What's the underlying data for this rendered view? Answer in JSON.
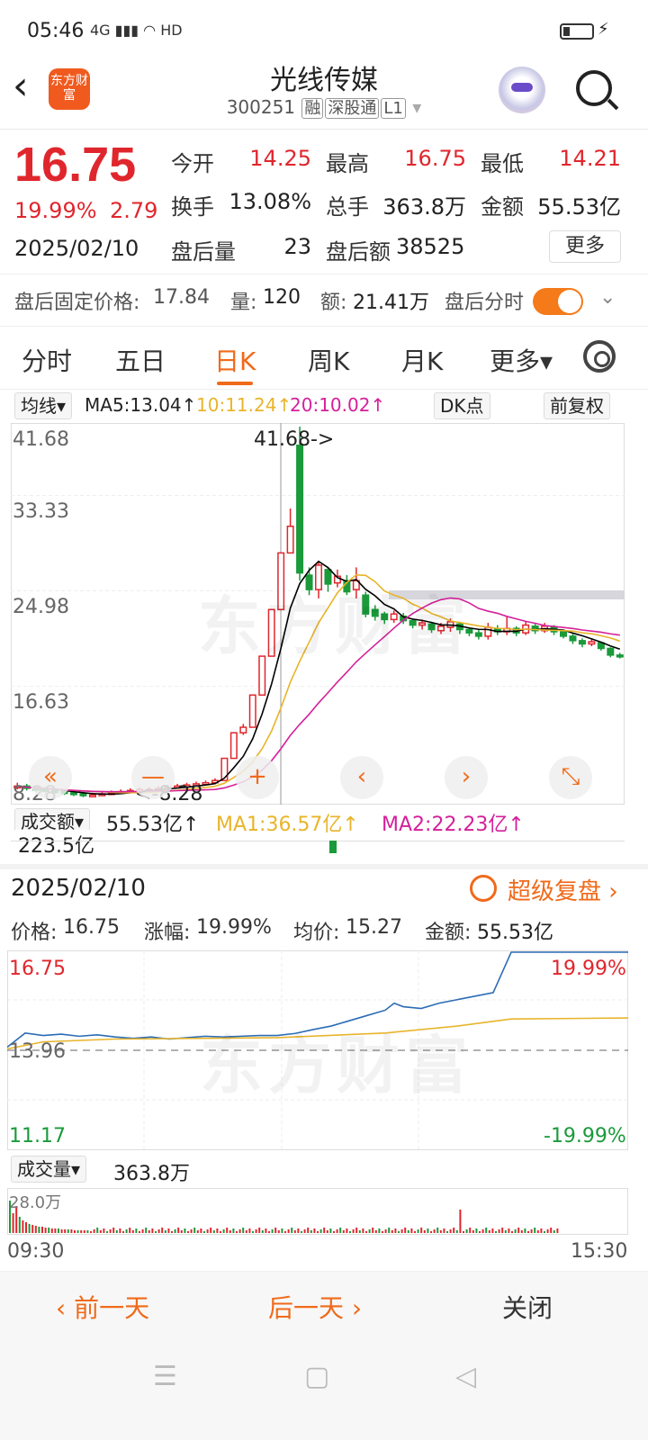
{
  "status": {
    "time": "05:46",
    "signal": "4G ▮▮▮ ◠ HD"
  },
  "header": {
    "name": "光线传媒",
    "code": "300251",
    "tags": [
      "融",
      "深股通",
      "L1"
    ],
    "logo_text": "东方财富"
  },
  "quote": {
    "price": "16.75",
    "pct": "19.99%",
    "change": "2.79",
    "date": "2025/02/10",
    "open_label": "今开",
    "open": "14.25",
    "high_label": "最高",
    "high": "16.75",
    "low_label": "最低",
    "low": "14.21",
    "turnover_label": "换手",
    "turnover": "13.08%",
    "volume_label": "总手",
    "volume": "363.8万",
    "amount_label": "金额",
    "amount": "55.53亿",
    "after_vol_label": "盘后量",
    "after_vol": "23",
    "after_amt_label": "盘后额",
    "after_amt": "38525",
    "more": "更多"
  },
  "after_hours": {
    "fixed_label": "盘后固定价格:",
    "fixed": "17.84",
    "qty_label": "量:",
    "qty": "120",
    "amt_label": "额:",
    "amt": "21.41万",
    "switch_label": "盘后分时"
  },
  "tabs": [
    "分时",
    "五日",
    "日K",
    "周K",
    "月K",
    "更多▾"
  ],
  "kline": {
    "ma_select": "均线▾",
    "ma5": "MA5:13.04↑",
    "ma10": "10:11.24↑",
    "ma20": "20:10.02↑",
    "dk": "DK点",
    "adjust": "前复权",
    "y_labels": [
      "41.68",
      "33.33",
      "24.98",
      "16.63",
      "8.28"
    ],
    "max_note": "41.68->",
    "min_note": "<-8.28",
    "vol_select": "成交额▾",
    "vol_value": "55.53亿↑",
    "vol_ma1": "MA1:36.57亿↑",
    "vol_ma2": "MA2:22.23亿↑",
    "vol_max": "223.5亿",
    "watermark": "东方财富",
    "nav": [
      "«",
      "—",
      "+",
      "‹",
      "›",
      "⤡"
    ],
    "colors": {
      "up": "#e0262d",
      "down": "#1a9a3a",
      "ma5": "#000000",
      "ma10": "#e8b42a",
      "ma20": "#d4209a"
    }
  },
  "detail": {
    "date": "2025/02/10",
    "replay": "超级复盘 ›",
    "price_label": "价格:",
    "price": "16.75",
    "pct_label": "涨幅:",
    "pct": "19.99%",
    "avg_label": "均价:",
    "avg": "15.27",
    "amt_label": "金额:",
    "amt": "55.53亿",
    "y_top": "16.75",
    "y_mid": "13.96",
    "y_bot": "11.17",
    "pct_top": "19.99%",
    "pct_bot": "-19.99%",
    "vol_select": "成交量▾",
    "vol_total": "363.8万",
    "vol_max": "28.0万",
    "t_start": "09:30",
    "t_end": "15:30"
  },
  "bottom": {
    "prev": "‹ 前一天",
    "next": "后一天 ›",
    "close": "关闭"
  },
  "sys": {
    "menu": "☰",
    "home": "▢",
    "back": "◁"
  }
}
